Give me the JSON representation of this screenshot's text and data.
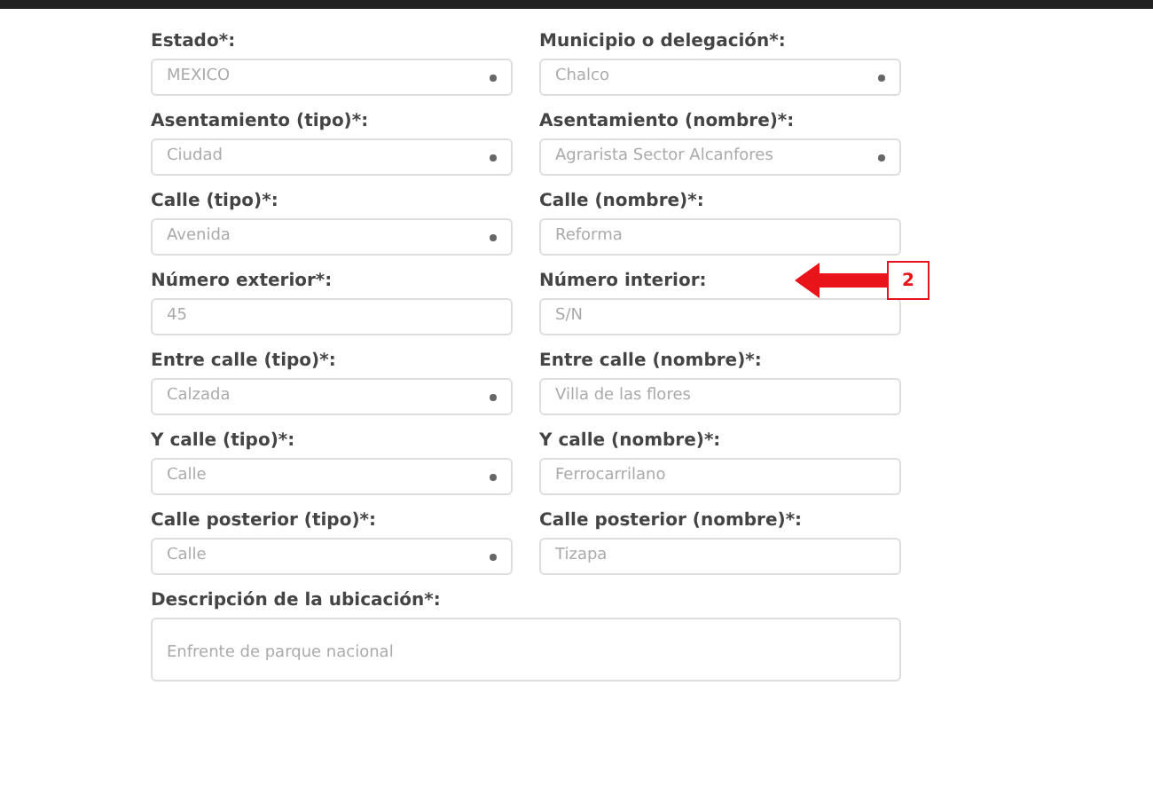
{
  "fields": [
    {
      "label": "Estado*:",
      "kind": "select",
      "value": "MEXICO"
    },
    {
      "label": "Municipio o delegación*:",
      "kind": "select",
      "value": "Chalco"
    },
    {
      "label": "Asentamiento (tipo)*:",
      "kind": "select",
      "value": "Ciudad"
    },
    {
      "label": "Asentamiento (nombre)*:",
      "kind": "select",
      "value": "Agrarista Sector Alcanfores"
    },
    {
      "label": "Calle (tipo)*:",
      "kind": "select",
      "value": "Avenida"
    },
    {
      "label": "Calle (nombre)*:",
      "kind": "input",
      "value": "Reforma"
    },
    {
      "label": "Número exterior*:",
      "kind": "input",
      "value": "45"
    },
    {
      "label": "Número interior:",
      "kind": "input",
      "value": "S/N"
    },
    {
      "label": "Entre calle (tipo)*:",
      "kind": "select",
      "value": "Calzada"
    },
    {
      "label": "Entre calle (nombre)*:",
      "kind": "input",
      "value": "Villa de las flores"
    },
    {
      "label": "Y calle (tipo)*:",
      "kind": "select",
      "value": "Calle"
    },
    {
      "label": "Y calle (nombre)*:",
      "kind": "input",
      "value": "Ferrocarrilano"
    },
    {
      "label": "Calle posterior (tipo)*:",
      "kind": "select",
      "value": "Calle"
    },
    {
      "label": "Calle posterior (nombre)*:",
      "kind": "input",
      "value": "Tizapa"
    }
  ],
  "description": {
    "label": "Descripción de la ubicación*:",
    "value": "Enfrente de parque nacional"
  },
  "annotation": {
    "number": "2"
  }
}
